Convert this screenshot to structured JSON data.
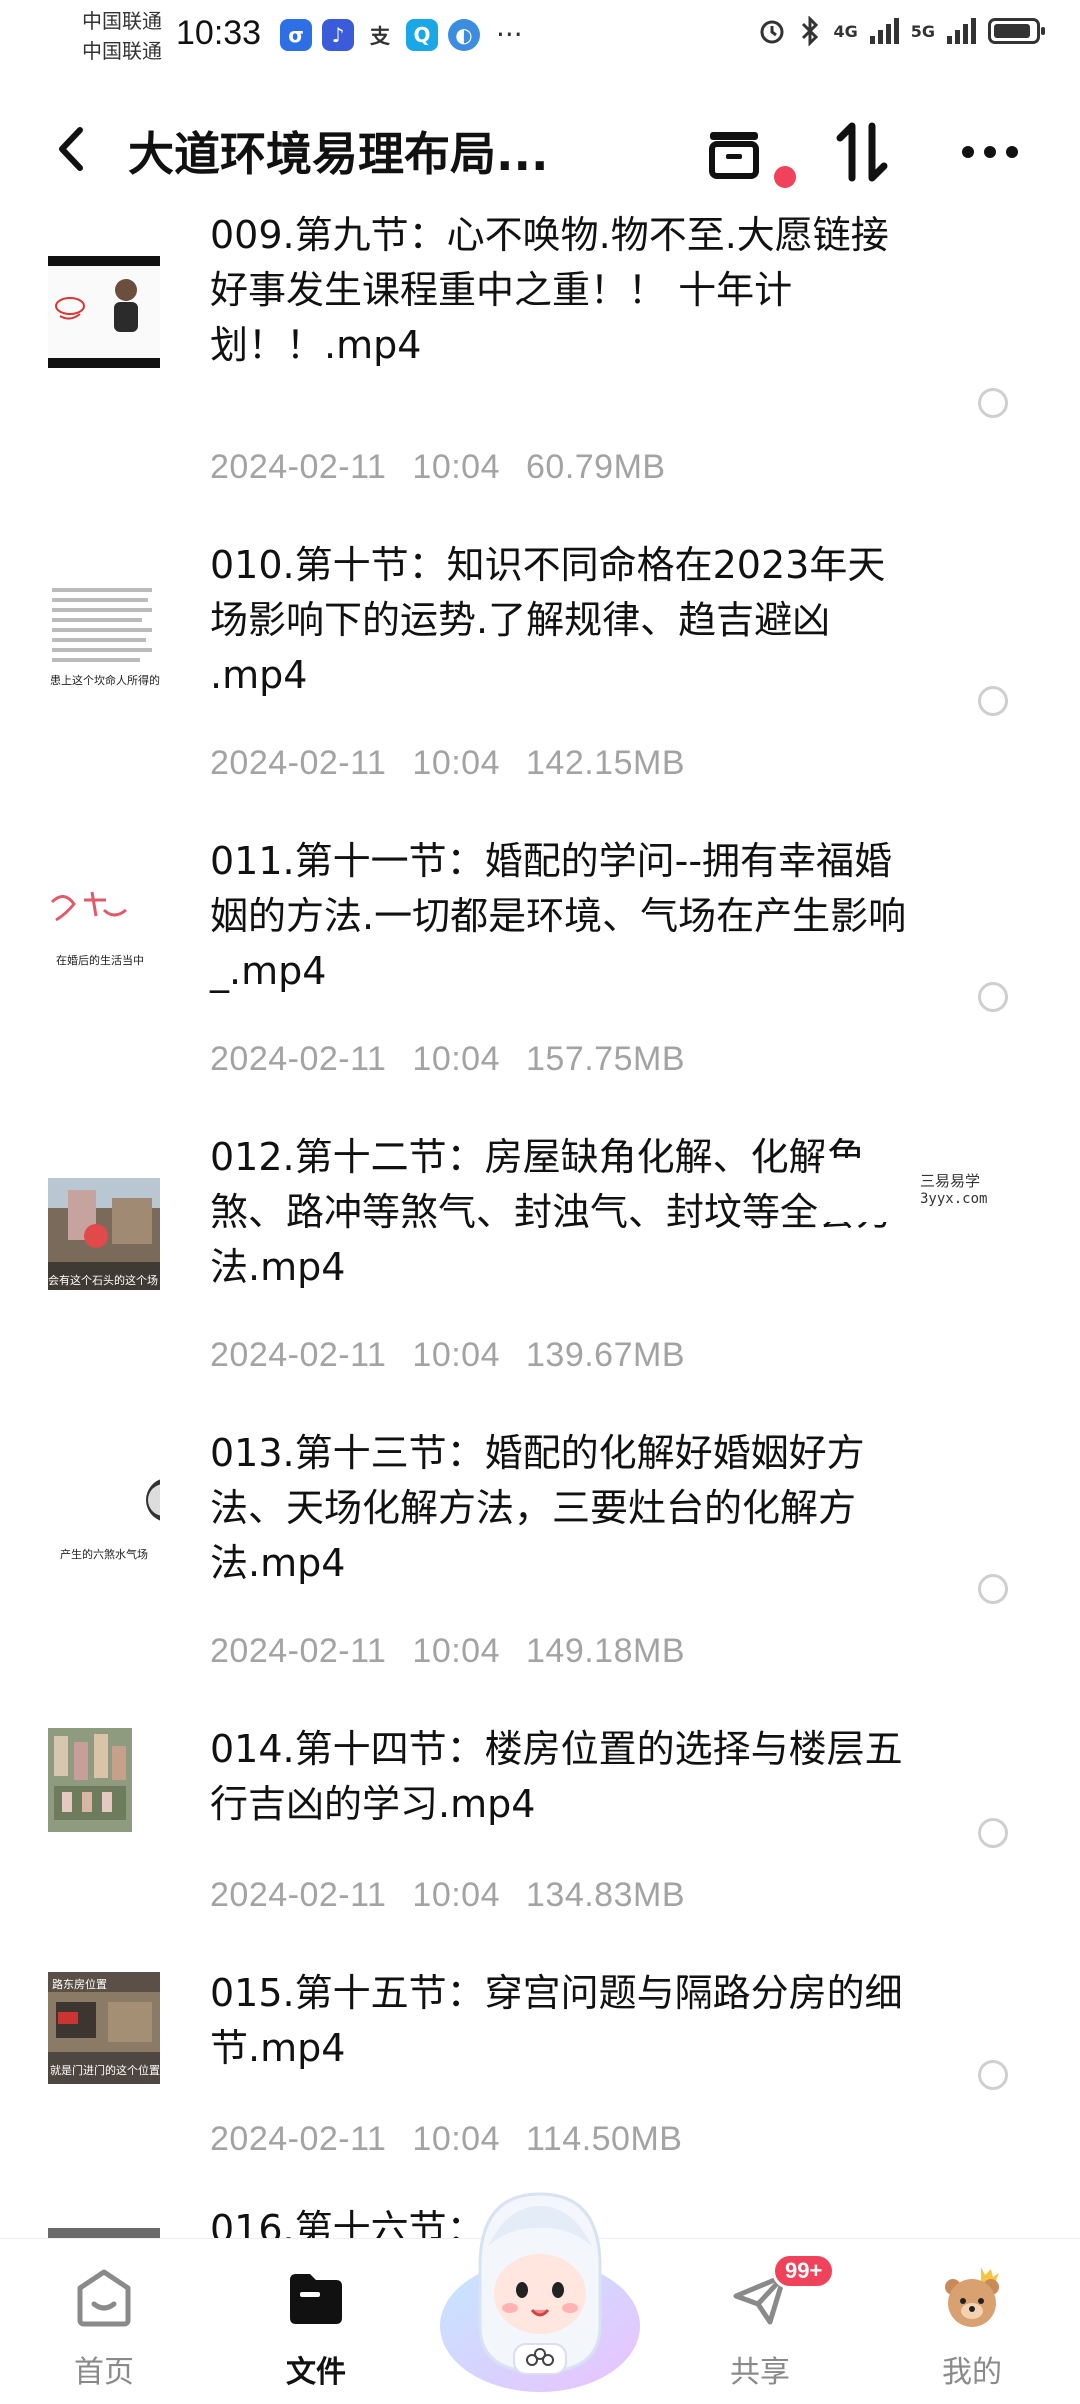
{
  "status_bar": {
    "carrier_1": "中国联通",
    "carrier_2": "中国联通",
    "time": "10:33",
    "network_1": "4G",
    "network_2": "5G"
  },
  "header": {
    "title": "大道环境易理布局..."
  },
  "files": [
    {
      "title": "009.第九节：心不唤物.物不至.大愿链接好事发生课程重中之重！！ 十年计划！！.mp4",
      "date": "2024-02-11",
      "time": "10:04",
      "size": "60.79MB"
    },
    {
      "title": "010.第十节：知识不同命格在2023年天场影响下的运势.了解规律、趋吉避凶 .mp4",
      "date": "2024-02-11",
      "time": "10:04",
      "size": "142.15MB"
    },
    {
      "title": "011.第十一节：婚配的学问--拥有幸福婚姻的方法.一切都是环境、气场在产生影响_.mp4",
      "date": "2024-02-11",
      "time": "10:04",
      "size": "157.75MB"
    },
    {
      "title": "012.第十二节：房屋缺角化解、化解角煞、路冲等煞气、封浊气、封坟等全套方法.mp4",
      "date": "2024-02-11",
      "time": "10:04",
      "size": "139.67MB"
    },
    {
      "title": "013.第十三节：婚配的化解好婚姻好方法、天场化解方法，三要灶台的化解方法.mp4",
      "date": "2024-02-11",
      "time": "10:04",
      "size": "149.18MB"
    },
    {
      "title": "014.第十四节：楼房位置的选择与楼层五行吉凶的学习.mp4",
      "date": "2024-02-11",
      "time": "10:04",
      "size": "134.83MB"
    },
    {
      "title": "015.第十五节：穿宫问题与隔路分房的细节.mp4",
      "date": "2024-02-11",
      "time": "10:04",
      "size": "114.50MB"
    },
    {
      "title": "016.第十六节：",
      "date": "",
      "time": "",
      "size": ""
    }
  ],
  "thumb_captions": {
    "t2": "患上这个坎命人所得的",
    "t3": "在婚后的生活当中",
    "t4": "会有这个石头的这个场",
    "t5": "产生的六煞水气场",
    "t7a": "路东房位置",
    "t7b": "就是门进门的这个位置"
  },
  "watermark": {
    "line1": "三易易学",
    "line2": "3yyx.com"
  },
  "nav": {
    "home": "首页",
    "files": "文件",
    "share": "共享",
    "share_badge": "99+",
    "mine": "我的"
  },
  "colors": {
    "accent": "#f0425a",
    "meta": "#a3a3a3"
  }
}
